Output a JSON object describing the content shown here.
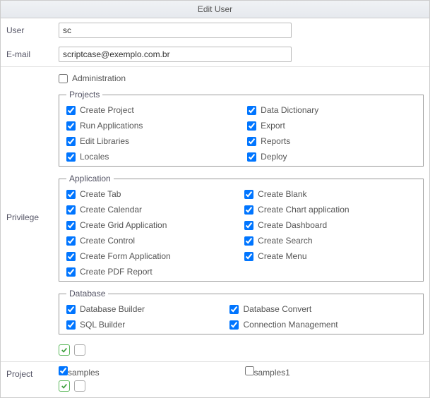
{
  "header": {
    "title": "Edit User"
  },
  "form": {
    "user": {
      "label": "User",
      "value": "sc"
    },
    "email": {
      "label": "E-mail",
      "value": "scriptcase@exemplo.com.br"
    },
    "privilege": {
      "label": "Privilege",
      "administration": {
        "label": "Administration",
        "checked": false
      },
      "groups": {
        "projects": {
          "legend": "Projects",
          "items_col1": [
            {
              "label": "Create Project",
              "checked": true
            },
            {
              "label": "Run Applications",
              "checked": true
            },
            {
              "label": "Edit Libraries",
              "checked": true
            },
            {
              "label": "Locales",
              "checked": true
            }
          ],
          "items_col2": [
            {
              "label": "Data Dictionary",
              "checked": true
            },
            {
              "label": "Export",
              "checked": true
            },
            {
              "label": "Reports",
              "checked": true
            },
            {
              "label": "Deploy",
              "checked": true
            }
          ]
        },
        "application": {
          "legend": "Application",
          "items_col1": [
            {
              "label": "Create Tab",
              "checked": true
            },
            {
              "label": "Create Calendar",
              "checked": true
            },
            {
              "label": "Create Grid Application",
              "checked": true
            },
            {
              "label": "Create Control",
              "checked": true
            },
            {
              "label": "Create Form Application",
              "checked": true
            },
            {
              "label": "Create PDF Report",
              "checked": true
            }
          ],
          "items_col2": [
            {
              "label": "Create Blank",
              "checked": true
            },
            {
              "label": "Create Chart application",
              "checked": true
            },
            {
              "label": "Create Dashboard",
              "checked": true
            },
            {
              "label": "Create Search",
              "checked": true
            },
            {
              "label": "Create Menu",
              "checked": true
            }
          ]
        },
        "database": {
          "legend": "Database",
          "items_col1": [
            {
              "label": "Database Builder",
              "checked": true
            },
            {
              "label": "SQL Builder",
              "checked": true
            }
          ],
          "items_col2": [
            {
              "label": "Database Convert",
              "checked": true
            },
            {
              "label": "Connection Management",
              "checked": true
            }
          ]
        }
      }
    },
    "project": {
      "label": "Project",
      "items": [
        {
          "label": "samples",
          "checked": true
        },
        {
          "label": "samples1",
          "checked": false
        }
      ]
    }
  }
}
